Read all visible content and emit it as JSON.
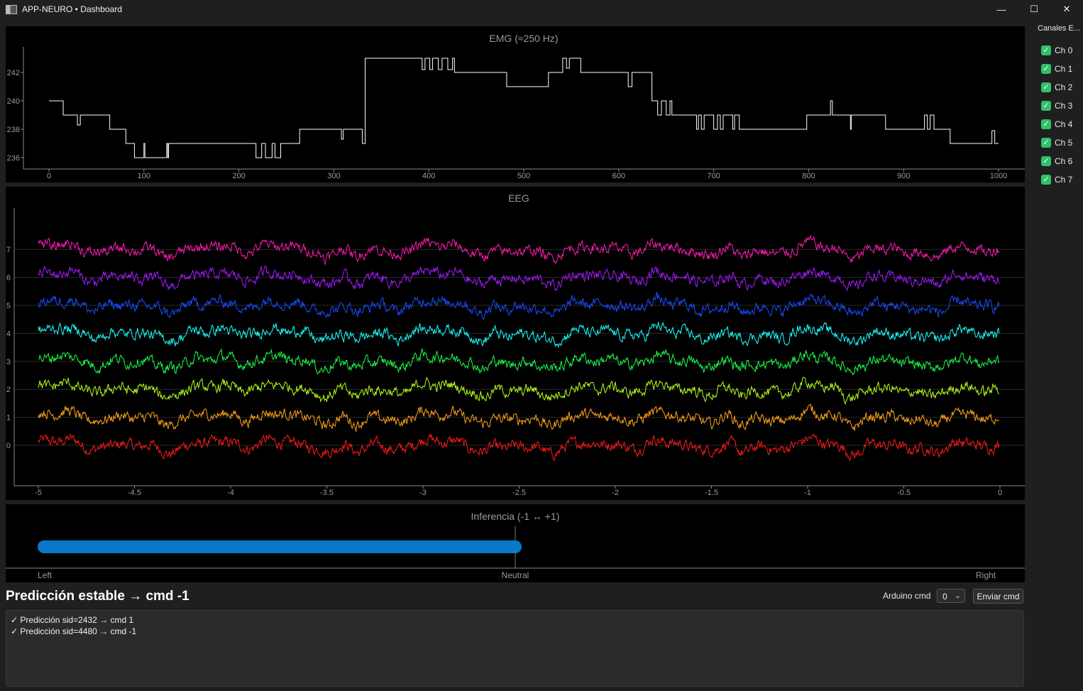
{
  "window": {
    "title": "APP-NEURO • Dashboard",
    "min_glyph": "—",
    "max_glyph": "☐",
    "close_glyph": "✕"
  },
  "emg": {
    "title": "EMG (≈250 Hz)",
    "color": "#ffffff",
    "xticks": [
      "0",
      "100",
      "200",
      "300",
      "400",
      "500",
      "600",
      "700",
      "800",
      "900",
      "1000"
    ],
    "yticks": [
      "236",
      "238",
      "240",
      "242"
    ],
    "xlim": [
      0,
      1000
    ],
    "ylim": [
      235.2,
      243.8
    ],
    "steps": [
      [
        0,
        240
      ],
      [
        15,
        239
      ],
      [
        30,
        238.3
      ],
      [
        33,
        239
      ],
      [
        64,
        238
      ],
      [
        81,
        237
      ],
      [
        90,
        236
      ],
      [
        100,
        237
      ],
      [
        101,
        236
      ],
      [
        124,
        237
      ],
      [
        125,
        236
      ],
      [
        126,
        237
      ],
      [
        154,
        237
      ],
      [
        210,
        237
      ],
      [
        218,
        236
      ],
      [
        224,
        237
      ],
      [
        228,
        236
      ],
      [
        235,
        237
      ],
      [
        238,
        236
      ],
      [
        244,
        237
      ],
      [
        263,
        237
      ],
      [
        264,
        238
      ],
      [
        308,
        237.3
      ],
      [
        310,
        238
      ],
      [
        330,
        237
      ],
      [
        333,
        243
      ],
      [
        390,
        243
      ],
      [
        393,
        242.2
      ],
      [
        396,
        243
      ],
      [
        401,
        242.2
      ],
      [
        404,
        243
      ],
      [
        410,
        242.2
      ],
      [
        414,
        243
      ],
      [
        420,
        242.2
      ],
      [
        425,
        243
      ],
      [
        427,
        242
      ],
      [
        480,
        242
      ],
      [
        482,
        241
      ],
      [
        520,
        241
      ],
      [
        526,
        242
      ],
      [
        538,
        242
      ],
      [
        541,
        243
      ],
      [
        545,
        242.3
      ],
      [
        548,
        243
      ],
      [
        560,
        242
      ],
      [
        608,
        242
      ],
      [
        610,
        241
      ],
      [
        614,
        242
      ],
      [
        635,
        240
      ],
      [
        641,
        239
      ],
      [
        645,
        240
      ],
      [
        650,
        239
      ],
      [
        654,
        240
      ],
      [
        656,
        239
      ],
      [
        680,
        239
      ],
      [
        682,
        238
      ],
      [
        684,
        239
      ],
      [
        687,
        238
      ],
      [
        690,
        239
      ],
      [
        700,
        238
      ],
      [
        704,
        239
      ],
      [
        707,
        238
      ],
      [
        710,
        239
      ],
      [
        720,
        238
      ],
      [
        722,
        239
      ],
      [
        727,
        238
      ],
      [
        795,
        238
      ],
      [
        798,
        239
      ],
      [
        823,
        240
      ],
      [
        825,
        239
      ],
      [
        843,
        239
      ],
      [
        844,
        238
      ],
      [
        845,
        239
      ],
      [
        880,
        239
      ],
      [
        881,
        238
      ],
      [
        920,
        238
      ],
      [
        922,
        239
      ],
      [
        925,
        238
      ],
      [
        928,
        239
      ],
      [
        932,
        238
      ],
      [
        948,
        238
      ],
      [
        949,
        237
      ],
      [
        990,
        237
      ],
      [
        993,
        237.9
      ],
      [
        996,
        237
      ],
      [
        1000,
        237
      ]
    ]
  },
  "eeg": {
    "title": "EEG",
    "xticks": [
      "-5",
      "-4.5",
      "-4",
      "-3.5",
      "-3",
      "-2.5",
      "-2",
      "-1.5",
      "-1",
      "-0.5",
      "0"
    ],
    "yticks": [
      "0",
      "1",
      "2",
      "3",
      "4",
      "5",
      "6",
      "7"
    ],
    "xlim": [
      -5,
      0
    ],
    "ylim": [
      -1.4,
      8.5
    ],
    "channels": [
      {
        "name": "Ch 0",
        "offset": 0,
        "color": "#ff1a1a"
      },
      {
        "name": "Ch 1",
        "offset": 1,
        "color": "#ffa31a"
      },
      {
        "name": "Ch 2",
        "offset": 2,
        "color": "#b3ff1a"
      },
      {
        "name": "Ch 3",
        "offset": 3,
        "color": "#1aff4d"
      },
      {
        "name": "Ch 4",
        "offset": 4,
        "color": "#1affff"
      },
      {
        "name": "Ch 5",
        "offset": 5,
        "color": "#1a4dff"
      },
      {
        "name": "Ch 6",
        "offset": 6,
        "color": "#a31aff"
      },
      {
        "name": "Ch 7",
        "offset": 7,
        "color": "#ff1ab3"
      }
    ]
  },
  "inference": {
    "title": "Inferencia (-1 ↔ +1)",
    "value": -1,
    "bar_color": "#0a78c8",
    "labels": {
      "left": "Left",
      "center": "Neutral",
      "right": "Right"
    }
  },
  "sidebar": {
    "title": "Canales E...",
    "check_glyph": "✓",
    "channels": [
      "Ch 0",
      "Ch 1",
      "Ch 2",
      "Ch 3",
      "Ch 4",
      "Ch 5",
      "Ch 6",
      "Ch 7"
    ]
  },
  "status": {
    "text": "Predicción estable → cmd -1"
  },
  "controls": {
    "arduino_label": "Arduino cmd",
    "arduino_value": "0",
    "send_label": "Enviar cmd"
  },
  "log": {
    "lines": [
      "✓ Predicción sid=2432 → cmd 1",
      "✓ Predicción sid=4480 → cmd -1"
    ]
  }
}
